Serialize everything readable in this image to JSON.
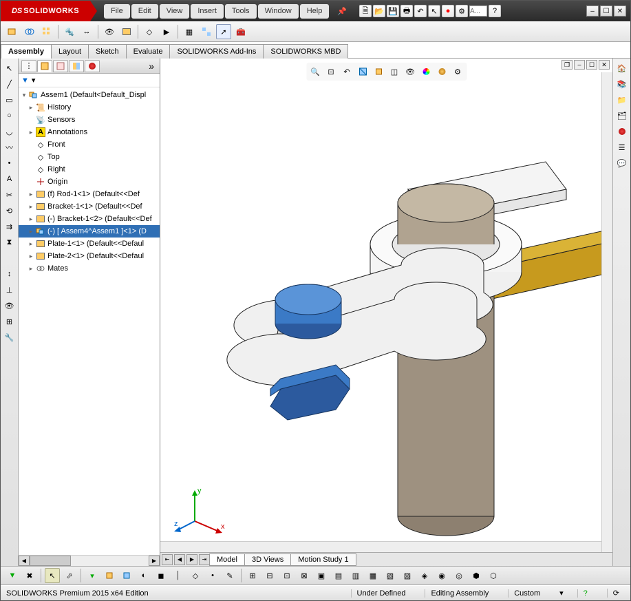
{
  "app": {
    "title": "SOLIDWORKS",
    "logo_prefix": "DS",
    "search_placeholder": "A..."
  },
  "menubar": [
    "File",
    "Edit",
    "View",
    "Insert",
    "Tools",
    "Window",
    "Help"
  ],
  "command_manager_tabs": [
    {
      "label": "Assembly",
      "active": true
    },
    {
      "label": "Layout",
      "active": false
    },
    {
      "label": "Sketch",
      "active": false
    },
    {
      "label": "Evaluate",
      "active": false
    },
    {
      "label": "SOLIDWORKS Add-Ins",
      "active": false
    },
    {
      "label": "SOLIDWORKS MBD",
      "active": false
    }
  ],
  "feature_tree": {
    "root": "Assem1  (Default<Default_Displ",
    "nodes": [
      {
        "icon": "history",
        "label": "History",
        "expandable": true
      },
      {
        "icon": "sensor",
        "label": "Sensors",
        "expandable": false
      },
      {
        "icon": "annotation",
        "label": "Annotations",
        "expandable": true
      },
      {
        "icon": "plane",
        "label": "Front",
        "expandable": false
      },
      {
        "icon": "plane",
        "label": "Top",
        "expandable": false
      },
      {
        "icon": "plane",
        "label": "Right",
        "expandable": false
      },
      {
        "icon": "origin",
        "label": "Origin",
        "expandable": false
      },
      {
        "icon": "part-fixed",
        "label": "(f) Rod-1<1> (Default<<Def",
        "expandable": true
      },
      {
        "icon": "part",
        "label": "Bracket-1<1> (Default<<Def",
        "expandable": true
      },
      {
        "icon": "part",
        "label": "(-) Bracket-1<2> (Default<<Def",
        "expandable": true
      },
      {
        "icon": "assembly",
        "label": "(-) [ Assem4^Assem1 ]<1> (D",
        "expandable": true,
        "selected": true
      },
      {
        "icon": "part",
        "label": "Plate-1<1> (Default<<Defaul",
        "expandable": true
      },
      {
        "icon": "part",
        "label": "Plate-2<1> (Default<<Defaul",
        "expandable": true
      },
      {
        "icon": "mates",
        "label": "Mates",
        "expandable": true
      }
    ]
  },
  "doc_tabs": [
    {
      "label": "Model",
      "active": true
    },
    {
      "label": "3D Views",
      "active": false
    },
    {
      "label": "Motion Study 1",
      "active": false
    }
  ],
  "statusbar": {
    "edition": "SOLIDWORKS Premium 2015 x64 Edition",
    "constraint_status": "Under Defined",
    "edit_mode": "Editing Assembly",
    "unit_system": "Custom"
  },
  "triad": {
    "axes": [
      "x",
      "y",
      "z"
    ]
  },
  "colors": {
    "brand_red": "#c00",
    "selection_blue": "#2f6fb5",
    "part_blue": "#3b7ac6",
    "part_tan": "#b5a178",
    "part_gold": "#c79a1e",
    "part_white": "#f0f0f0"
  }
}
